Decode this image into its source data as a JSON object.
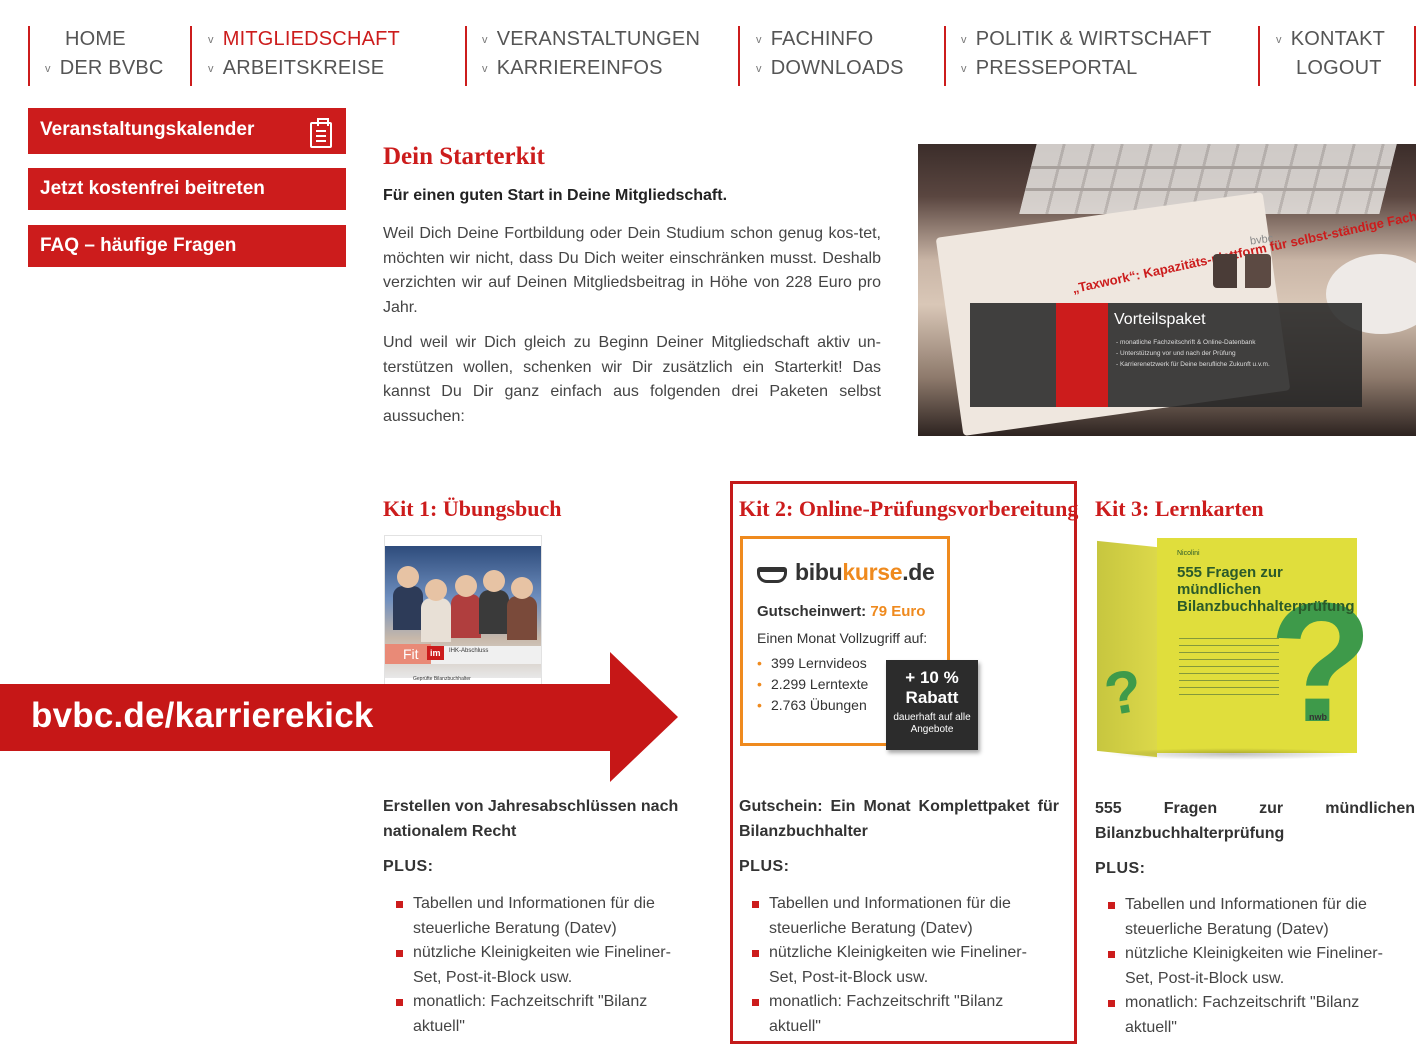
{
  "nav": {
    "items": [
      {
        "label": "HOME",
        "chevron": false,
        "active": false
      },
      {
        "label": "DER BVBC",
        "chevron": true,
        "active": false
      },
      {
        "label": "MITGLIEDSCHAFT",
        "chevron": true,
        "active": true
      },
      {
        "label": "ARBEITSKREISE",
        "chevron": true,
        "active": false
      },
      {
        "label": "VERANSTALTUNGEN",
        "chevron": true,
        "active": false
      },
      {
        "label": "KARRIEREINFOS",
        "chevron": true,
        "active": false
      },
      {
        "label": "FACHINFO",
        "chevron": true,
        "active": false
      },
      {
        "label": "DOWNLOADS",
        "chevron": true,
        "active": false
      },
      {
        "label": "POLITIK & WIRTSCHAFT",
        "chevron": true,
        "active": false
      },
      {
        "label": "PRESSEPORTAL",
        "chevron": true,
        "active": false
      },
      {
        "label": "KONTAKT",
        "chevron": true,
        "active": false
      },
      {
        "label": "LOGOUT",
        "chevron": false,
        "active": false
      }
    ],
    "chevron_glyph": "v",
    "accent": "#cc1c1c"
  },
  "sidebar": {
    "buttons": [
      {
        "label": "Veranstaltungskalender",
        "icon": "calendar-icon"
      },
      {
        "label": "Jetzt kostenfrei beitreten"
      },
      {
        "label": "FAQ – häufige Fragen"
      }
    ]
  },
  "intro": {
    "title": "Dein Starterkit",
    "lead": "Für einen guten Start in Deine Mitgliedschaft.",
    "para1": "Weil Dich Deine Fortbildung oder Dein Studium schon genug kos-tet, möchten wir nicht, dass Du Dich weiter einschränken musst. Deshalb verzichten wir auf Deinen Mitgliedsbeitrag in Höhe von 228 Euro pro Jahr.",
    "para2": "Und weil wir Dich gleich zu Beginn Deiner Mitgliedschaft aktiv un-terstützen wollen, schenken wir Dir zusätzlich ein Starterkit! Das kannst Du Dir ganz einfach aus folgenden drei Paketen selbst aussuchen:"
  },
  "hero": {
    "book_text": "„Taxwork“: Kapazitäts-plattform für selbst-ständige Fachexperten",
    "book_logo": "bvbc",
    "overlay_title": "Vorteilspaket",
    "overlay_lines": [
      "- monatliche Fachzeitschrift & Online-Datenbank",
      "- Unterstützung vor und nach der Prüfung",
      "- Karrierenetzwerk für Deine berufliche Zukunft u.v.m."
    ]
  },
  "kits": [
    {
      "title": "Kit 1: Übungsbuch",
      "cover": {
        "fit": "Fit",
        "im": "im",
        "ihk": "IHK-Abschluss",
        "sub": "Geprüfte Bilanzbuchhalter"
      },
      "description": "Erstellen von Jahresabschlüssen nach nationalem Recht",
      "plus": "PLUS:",
      "bullets": [
        "Tabellen und Informationen für die steuerliche Beratung (Datev)",
        "nützliche Kleinigkeiten wie Fineliner-Set, Post-it-Block usw.",
        "monatlich: Fachzeitschrift \"Bilanz aktuell\""
      ]
    },
    {
      "title": "Kit 2: Online-Prüfungsvorbereitung",
      "card": {
        "logo_main": "bibu",
        "logo_accent": "kurse",
        "logo_tld": ".de",
        "voucher_label": "Gutscheinwert:",
        "voucher_value": "79 Euro",
        "month_text": "Einen Monat Vollzugriff auf:",
        "items": [
          "399 Lernvideos",
          "2.299 Lerntexte",
          "2.763 Übungen"
        ],
        "badge_pct": "+ 10 %",
        "badge_label": "Rabatt",
        "badge_sub": "dauerhaft auf alle Angebote",
        "accent": "#ef8a1e"
      },
      "description": "Gutschein: Ein Monat Komplettpaket für Bilanzbuchhalter",
      "plus": "PLUS:",
      "bullets": [
        "Tabellen und Informationen für die steuerliche Beratung (Datev)",
        "nützliche Kleinigkeiten wie Fineliner-Set, Post-it-Block usw.",
        "monatlich: Fachzeitschrift \"Bilanz aktuell\""
      ]
    },
    {
      "title": "Kit 3: Lernkarten",
      "box": {
        "author": "Nicolini",
        "title": "555 Fragen zur mündlichen Bilanzbuchhalterprüfung",
        "publisher": "nwb"
      },
      "description": "555 Fragen zur mündlichen Bilanzbuchhalterprüfung",
      "plus": "PLUS:",
      "bullets": [
        "Tabellen und Informationen für die steuerliche Beratung (Datev)",
        "nützliche Kleinigkeiten wie Fineliner-Set, Post-it-Block usw.",
        "monatlich: Fachzeitschrift \"Bilanz aktuell\""
      ]
    }
  ],
  "callout": {
    "text": "bvbc.de/karrierekick",
    "color": "#c61717"
  }
}
